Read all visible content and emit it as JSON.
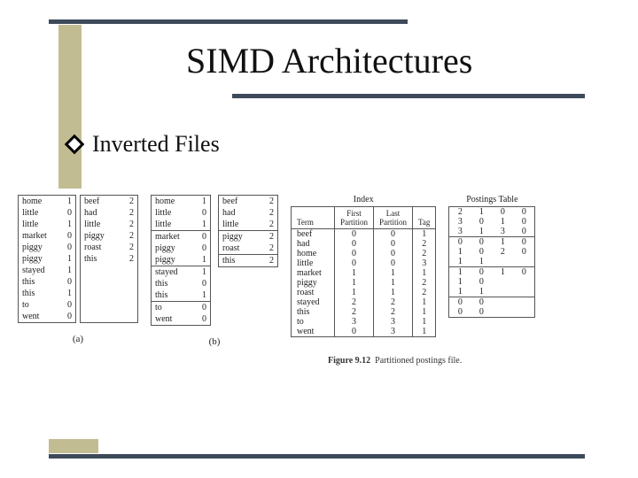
{
  "title": "SIMD Architectures",
  "bullet": "Inverted Files",
  "labels": {
    "a": "(a)",
    "b": "(b)"
  },
  "caption": {
    "fig": "Figure 9.12",
    "text": "Partitioned postings file."
  },
  "tableA": {
    "left": [
      [
        "home",
        "1"
      ],
      [
        "little",
        "0"
      ],
      [
        "little",
        "1"
      ],
      [
        "market",
        "0"
      ],
      [
        "piggy",
        "0"
      ],
      [
        "piggy",
        "1"
      ],
      [
        "stayed",
        "1"
      ],
      [
        "this",
        "0"
      ],
      [
        "this",
        "1"
      ],
      [
        "to",
        "0"
      ],
      [
        "went",
        "0"
      ]
    ],
    "right": [
      [
        "beef",
        "2"
      ],
      [
        "had",
        "2"
      ],
      [
        "little",
        "2"
      ],
      [
        "piggy",
        "2"
      ],
      [
        "roast",
        "2"
      ],
      [
        "this",
        "2"
      ]
    ]
  },
  "tableB": {
    "leftSegments": [
      [
        [
          "home",
          "1"
        ],
        [
          "little",
          "0"
        ],
        [
          "little",
          "1"
        ]
      ],
      [
        [
          "market",
          "0"
        ],
        [
          "piggy",
          "0"
        ],
        [
          "piggy",
          "1"
        ]
      ],
      [
        [
          "stayed",
          "1"
        ],
        [
          "this",
          "0"
        ],
        [
          "this",
          "1"
        ]
      ],
      [
        [
          "to",
          "0"
        ],
        [
          "went",
          "0"
        ]
      ]
    ],
    "rightSegments": [
      [
        [
          "beef",
          "2"
        ],
        [
          "had",
          "2"
        ],
        [
          "little",
          "2"
        ]
      ],
      [
        [
          "piggy",
          "2"
        ],
        [
          "roast",
          "2"
        ]
      ],
      [
        [
          "this",
          "2"
        ]
      ]
    ]
  },
  "indexTable": {
    "title": "Index",
    "headers": [
      "Term",
      "First\nPartition",
      "Last\nPartition",
      "Tag"
    ],
    "rows": [
      [
        "beef",
        "0",
        "0",
        "1"
      ],
      [
        "had",
        "0",
        "0",
        "2"
      ],
      [
        "home",
        "0",
        "0",
        "2"
      ],
      [
        "little",
        "0",
        "0",
        "3"
      ],
      [
        "market",
        "1",
        "1",
        "1"
      ],
      [
        "piggy",
        "1",
        "1",
        "2"
      ],
      [
        "roast",
        "1",
        "1",
        "2"
      ],
      [
        "stayed",
        "2",
        "2",
        "1"
      ],
      [
        "this",
        "2",
        "2",
        "1"
      ],
      [
        "to",
        "3",
        "3",
        "1"
      ],
      [
        "went",
        "0",
        "3",
        "1"
      ]
    ]
  },
  "postings": {
    "title": "Postings Table",
    "blocks": [
      [
        [
          "2",
          "1",
          "0",
          "0"
        ],
        [
          "3",
          "0",
          "1",
          "0"
        ],
        [
          "3",
          "1",
          "3",
          "0"
        ]
      ],
      [
        [
          "0",
          "0",
          "1",
          "0"
        ],
        [
          "1",
          "0",
          "2",
          "0"
        ],
        [
          "1",
          "1",
          "",
          ""
        ]
      ],
      [
        [
          "1",
          "0",
          "1",
          "0"
        ],
        [
          "1",
          "0",
          "",
          ""
        ],
        [
          "1",
          "1",
          "",
          ""
        ]
      ],
      [
        [
          "0",
          "0",
          "",
          ""
        ],
        [
          "0",
          "0",
          "",
          ""
        ]
      ]
    ]
  }
}
